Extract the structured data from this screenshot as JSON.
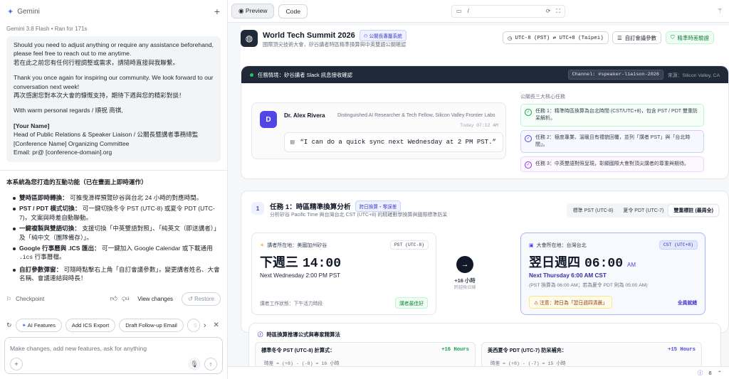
{
  "sidebar": {
    "app_name": "Gemini",
    "model": "Gemini 3.8 Flash",
    "run_info": "Ran for 171s",
    "letter": [
      "Should you need to adjust anything or require any assistance beforehand, please feel free to reach out to me anytime.",
      "若在此之前您有任何行程調整或需求，請隨時直接與我聯繫。",
      "Thank you once again for inspiring our community. We look forward to our conversation next week!",
      "再次感謝您對本次大會的慷慨支持，期待下週與您的精彩對談！",
      "With warm personal regards / 順祝 商祺,",
      "[Your Name]",
      "Head of Public Relations & Speaker Liaison / 公關長暨講者事務總監",
      "[Conference Name] Organizing Committee",
      "Email: pr@ [conference-domain].org"
    ],
    "features_title": "本系統為您打造的互動功能（已在畫面上即時運作）",
    "features": [
      {
        "bold": "雙時區即時轉換：",
        "text": " 可推曳滑桿預覽矽谷與台北 24 小時的對應時間。"
      },
      {
        "bold": "PST / PDT 模式切換：",
        "text": " 可一鍵切換冬令 PST (UTC-8) 或夏令 PDT (UTC-7)，文案與時差自動聯動。"
      },
      {
        "bold": "一鍵複製與雙語切換：",
        "text": " 支援切換「中英雙語對照」、「純英文（即送講者）」及「純中文（團隊備存）」。"
      },
      {
        "bold": "Google 行事曆與 .ICS 匯出：",
        "text": " 可一鍵加入 Google Calendar 或下載通用 ",
        "mono": ".ics",
        "tail": " 行事曆檔。"
      },
      {
        "bold": "自訂參數彈窗：",
        "text": " 可隨時點擊右上角「自訂會議參數」，變更講者姓名、大會名稱、會議連結與時長！"
      }
    ],
    "checkpoint": "Checkpoint",
    "view_changes": "View changes",
    "restore": "Restore",
    "suggestions": [
      "AI Features",
      "Add ICS Export",
      "Draft Follow-up Email",
      "S"
    ],
    "input_placeholder": "Make changes, add new features, ask for anything"
  },
  "topbar": {
    "tab_preview": "Preview",
    "tab_code": "Code",
    "url": "/"
  },
  "header": {
    "title": "World Tech Summit 2026",
    "tag": "公關長專屬系統",
    "subtitle": "國際頂尖技術大會，矽谷講者時區精準換算與中英雙語公關確認",
    "tz_button": "UTC-8 (PST) ⇄ UTC+8 (Taipei)",
    "custom_button": "自訂會議參數",
    "verify_button": "精準時差驗證"
  },
  "context": {
    "bar_title": "任務情境：矽谷講者 Slack 訊息接收確認",
    "channel": "Channel: #speaker-liaison-2026",
    "source": "來源：Silicon Valley, CA",
    "avatar_letter": "D",
    "sender": "Dr. Alex Rivera",
    "role": "Distinguished AI Researcher & Tech Fellow, Silicon Valley Frontier Labs",
    "time": "Today 07:12 AM",
    "quote": "“I can do a quick sync next Wednesday at 2 PM PST.”",
    "tasks_caption": "公關長三大核心任務",
    "tasks": [
      "任務 1：精準時區換算為台北時間 (CST/UTC+8)，包含 PST / PDT 雙重防呆解析。",
      "任務 2：極度專業、溫暖且有禮貌回覆，並列「講者 PST」與「台北時間」。",
      "任務 3：中英雙語對照呈現，彰顯國際大會對頂尖講者的尊重與期待。"
    ]
  },
  "task1": {
    "num": "1",
    "title": "任務 1：時區精準換算分析",
    "tag": "跨日換算・零誤差",
    "subtitle": "分析矽谷 Pacific Time 與台灣台北 CST (UTC+8) 的精確數學換算與國際標準防呆",
    "seg": [
      "標準 PST (UTC-8)",
      "夏令 PDT (UTC-7)",
      "雙重標註 (最周全)"
    ],
    "left": {
      "label": "講者所在地：美國加州矽谷",
      "badge": "PST (UTC-8)",
      "time_zh": "下週三",
      "time": "14:00",
      "en": "Next Wednesday 2:00 PM PST",
      "status": "講者工作狀態：下午活力時段",
      "status_badge": "講者最佳好"
    },
    "offset": "+16 小時",
    "offset_sub": "跨越換日線",
    "right": {
      "label": "大會所在地：台灣台北",
      "badge": "CST (UTC+8)",
      "time_zh": "翌日週四",
      "time": "06:00",
      "ampm": "AM",
      "en": "Next Thursday 6:00 AM CST",
      "en2": "(PST 換算為 06:00 AM；若為夏令 PDT 則為 05:00 AM)",
      "warn": "注意：跨日為「翌日週四清晨」",
      "ready": "全員就緒"
    }
  },
  "formula": {
    "title": "時區換算推導公式與專家精算法",
    "left_title": "標準冬令 PST (UTC-8) 計算式：",
    "left_value": "+16 Hours",
    "left_line": "時差 = (+8) - (-8) = 16 小時",
    "right_title": "美西夏令 PDT (UTC-7) 防呆補充：",
    "right_value": "+15 Hours",
    "right_line": "時差 = (+8) - (-7) = 15 小時"
  },
  "statusbar": {
    "count": "8"
  },
  "colors": {
    "accent": "#4f46e5",
    "dark": "#1f2937",
    "green": "#16a34a",
    "purple": "#9333ea"
  }
}
